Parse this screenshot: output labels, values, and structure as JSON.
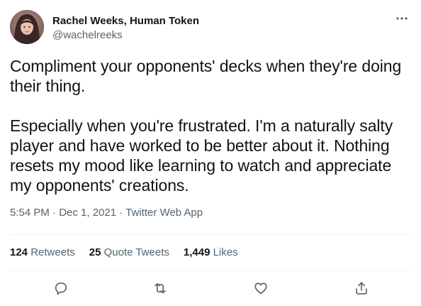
{
  "author": {
    "display_name": "Rachel Weeks, Human Token",
    "handle": "@wachelreeks",
    "avatar_icon": "user-avatar"
  },
  "more_icon": "more-horizontal-icon",
  "tweet": {
    "text": "Compliment your opponents' decks when they're doing their thing.\n\nEspecially when you're frustrated. I'm a naturally salty player and have worked to be better about it. Nothing resets my mood like learning to watch and appreciate my opponents' creations."
  },
  "meta": {
    "time": "5:54 PM",
    "separator": " · ",
    "date": "Dec 1, 2021",
    "source": "Twitter Web App"
  },
  "stats": {
    "retweets": {
      "count": "124",
      "label": "Retweets"
    },
    "quotes": {
      "count": "25",
      "label": "Quote Tweets"
    },
    "likes": {
      "count": "1,449",
      "label": "Likes"
    }
  },
  "actions": [
    {
      "icon": "reply-icon"
    },
    {
      "icon": "retweet-icon"
    },
    {
      "icon": "like-heart-icon"
    },
    {
      "icon": "share-icon"
    }
  ],
  "colors": {
    "text": "#0f1419",
    "secondary": "#536471",
    "divider": "#eff3f4"
  }
}
